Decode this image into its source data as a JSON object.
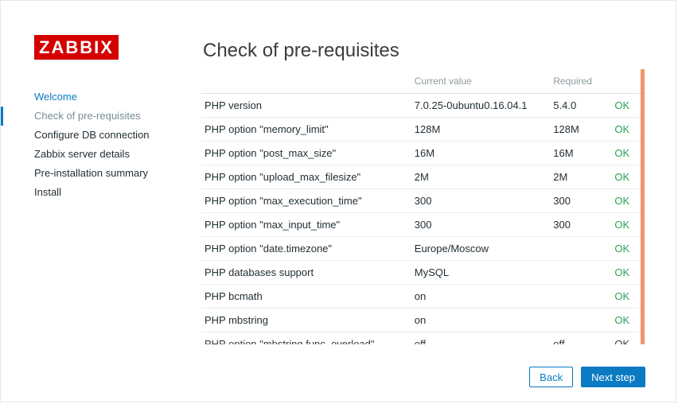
{
  "logo": "ZABBIX",
  "title": "Check of pre-requisites",
  "sidebar": {
    "items": [
      {
        "label": "Welcome",
        "state": "done"
      },
      {
        "label": "Check of pre-requisites",
        "state": "active"
      },
      {
        "label": "Configure DB connection",
        "state": ""
      },
      {
        "label": "Zabbix server details",
        "state": ""
      },
      {
        "label": "Pre-installation summary",
        "state": ""
      },
      {
        "label": "Install",
        "state": ""
      }
    ]
  },
  "table": {
    "headers": {
      "name": "",
      "current": "Current value",
      "required": "Required",
      "status": ""
    },
    "rows": [
      {
        "name": "PHP version",
        "current": "7.0.25-0ubuntu0.16.04.1",
        "required": "5.4.0",
        "status": "OK"
      },
      {
        "name": "PHP option \"memory_limit\"",
        "current": "128M",
        "required": "128M",
        "status": "OK"
      },
      {
        "name": "PHP option \"post_max_size\"",
        "current": "16M",
        "required": "16M",
        "status": "OK"
      },
      {
        "name": "PHP option \"upload_max_filesize\"",
        "current": "2M",
        "required": "2M",
        "status": "OK"
      },
      {
        "name": "PHP option \"max_execution_time\"",
        "current": "300",
        "required": "300",
        "status": "OK"
      },
      {
        "name": "PHP option \"max_input_time\"",
        "current": "300",
        "required": "300",
        "status": "OK"
      },
      {
        "name": "PHP option \"date.timezone\"",
        "current": "Europe/Moscow",
        "required": "",
        "status": "OK"
      },
      {
        "name": "PHP databases support",
        "current": "MySQL",
        "required": "",
        "status": "OK"
      },
      {
        "name": "PHP bcmath",
        "current": "on",
        "required": "",
        "status": "OK"
      },
      {
        "name": "PHP mbstring",
        "current": "on",
        "required": "",
        "status": "OK"
      },
      {
        "name": "PHP option \"mbstring.func_overload\"",
        "current": "off",
        "required": "off",
        "status": "OK"
      }
    ]
  },
  "buttons": {
    "back": "Back",
    "next": "Next step"
  }
}
